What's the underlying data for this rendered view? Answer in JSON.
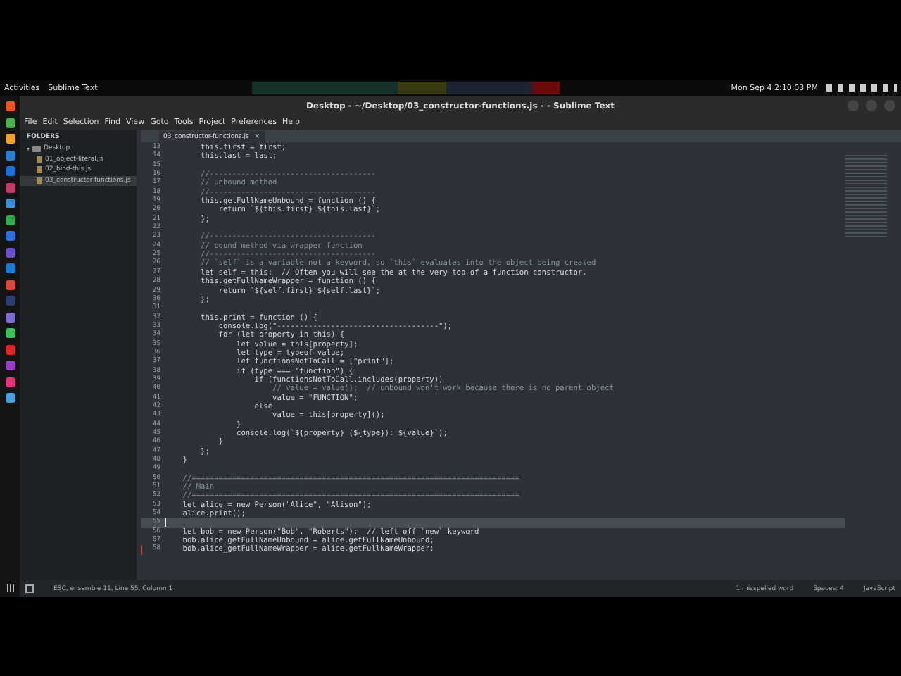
{
  "top_bar": {
    "activities": "Activities",
    "app": "Sublime Text",
    "clock": "Mon Sep 4  2:10:03 PM"
  },
  "dock": [
    {
      "color": "#e95420"
    },
    {
      "color": "#4caf50"
    },
    {
      "color": "#f0a030"
    },
    {
      "color": "#2a7fd4"
    },
    {
      "color": "#1e6fd9"
    },
    {
      "color": "#c43b6b"
    },
    {
      "color": "#3b8fd9"
    },
    {
      "color": "#2fa84f"
    },
    {
      "color": "#2d6ee0"
    },
    {
      "color": "#6a4fc7"
    },
    {
      "color": "#1b79d6"
    },
    {
      "color": "#d9483b"
    },
    {
      "color": "#2c3e70"
    },
    {
      "color": "#7a6fd0"
    },
    {
      "color": "#3bbf5a"
    },
    {
      "color": "#d92b2b"
    },
    {
      "color": "#a03bd0"
    },
    {
      "color": "#e0357a"
    },
    {
      "color": "#4a9fd8"
    }
  ],
  "window": {
    "title": "Desktop - ~/Desktop/03_constructor-functions.js - - Sublime Text"
  },
  "menu": [
    "File",
    "Edit",
    "Selection",
    "Find",
    "View",
    "Goto",
    "Tools",
    "Project",
    "Preferences",
    "Help"
  ],
  "sidebar": {
    "header": "FOLDERS",
    "folder": {
      "name": "Desktop",
      "expanded": true,
      "children": [
        {
          "name": "01_object-literal.js",
          "selected": false
        },
        {
          "name": "02_bind-this.js",
          "selected": false
        },
        {
          "name": "03_constructor-functions.js",
          "selected": true
        }
      ]
    }
  },
  "tabs": [
    {
      "label": "03_constructor-functions.js",
      "close": "×",
      "selected": true
    }
  ],
  "lines": [
    {
      "n": "13",
      "kind": "code",
      "text": "        this.first = first;",
      "current": false,
      "modified": false
    },
    {
      "n": "14",
      "kind": "code",
      "text": "        this.last = last;",
      "current": false,
      "modified": false
    },
    {
      "n": "15",
      "current": false,
      "modified": false
    },
    {
      "n": "16",
      "kind": "comment",
      "text": "        //-------------------------------------",
      "current": false,
      "modified": false
    },
    {
      "n": "17",
      "kind": "comment",
      "text": "        // unbound method",
      "current": false,
      "modified": false
    },
    {
      "n": "18",
      "kind": "comment",
      "text": "        //-------------------------------------",
      "current": false,
      "modified": false
    },
    {
      "n": "19",
      "kind": "code",
      "text": "        this.getFullNameUnbound = function () {",
      "current": false,
      "modified": false
    },
    {
      "n": "20",
      "kind": "code",
      "text": "            return `${this.first} ${this.last}`;",
      "current": false,
      "modified": false
    },
    {
      "n": "21",
      "kind": "code",
      "text": "        };",
      "current": false,
      "modified": false
    },
    {
      "n": "22",
      "current": false,
      "modified": false
    },
    {
      "n": "23",
      "kind": "comment",
      "text": "        //-------------------------------------",
      "current": false,
      "modified": false
    },
    {
      "n": "24",
      "kind": "comment",
      "text": "        // bound method via wrapper function",
      "current": false,
      "modified": false
    },
    {
      "n": "25",
      "kind": "comment",
      "text": "        //-------------------------------------",
      "current": false,
      "modified": false
    },
    {
      "n": "26",
      "kind": "comment",
      "text": "        // `self` is a variable not a keyword, so `this` evaluates into the object being created",
      "current": false,
      "modified": false
    },
    {
      "n": "27",
      "kind": "code",
      "text": "        let self = this;  // Often you will see the at the very top of a function constructor.",
      "current": false,
      "modified": false
    },
    {
      "n": "28",
      "kind": "code",
      "text": "        this.getFullNameWrapper = function () {",
      "current": false,
      "modified": false
    },
    {
      "n": "29",
      "kind": "code",
      "text": "            return `${self.first} ${self.last}`;",
      "current": false,
      "modified": false
    },
    {
      "n": "30",
      "kind": "code",
      "text": "        };",
      "current": false,
      "modified": false
    },
    {
      "n": "31",
      "current": false,
      "modified": false
    },
    {
      "n": "32",
      "kind": "code",
      "text": "        this.print = function () {",
      "current": false,
      "modified": false
    },
    {
      "n": "33",
      "kind": "code",
      "text": "            console.log(\"------------------------------------\");",
      "current": false,
      "modified": false
    },
    {
      "n": "34",
      "kind": "code",
      "text": "            for (let property in this) {",
      "current": false,
      "modified": false
    },
    {
      "n": "35",
      "kind": "code",
      "text": "                let value = this[property];",
      "current": false,
      "modified": false
    },
    {
      "n": "36",
      "kind": "code",
      "text": "                let type = typeof value;",
      "current": false,
      "modified": false
    },
    {
      "n": "37",
      "kind": "code",
      "text": "                let functionsNotToCall = [\"print\"];",
      "current": false,
      "modified": false
    },
    {
      "n": "38",
      "kind": "code",
      "text": "                if (type === \"function\") {",
      "current": false,
      "modified": false
    },
    {
      "n": "39",
      "kind": "code",
      "text": "                    if (functionsNotToCall.includes(property))",
      "current": false,
      "modified": false
    },
    {
      "n": "40",
      "kind": "comment",
      "text": "                        // value = value();  // unbound won't work because there is no parent object",
      "current": false,
      "modified": false
    },
    {
      "n": "41",
      "kind": "code",
      "text": "                        value = \"FUNCTION\";",
      "current": false,
      "modified": false
    },
    {
      "n": "42",
      "kind": "code",
      "text": "                    else",
      "current": false,
      "modified": false
    },
    {
      "n": "43",
      "kind": "code",
      "text": "                        value = this[property]();",
      "current": false,
      "modified": false
    },
    {
      "n": "44",
      "kind": "code",
      "text": "                }",
      "current": false,
      "modified": false
    },
    {
      "n": "45",
      "kind": "code",
      "text": "                console.log(`${property} (${type}): ${value}`);",
      "current": false,
      "modified": false
    },
    {
      "n": "46",
      "kind": "code",
      "text": "            }",
      "current": false,
      "modified": false
    },
    {
      "n": "47",
      "kind": "code",
      "text": "        };",
      "current": false,
      "modified": false
    },
    {
      "n": "48",
      "kind": "code",
      "text": "    }",
      "current": false,
      "modified": false
    },
    {
      "n": "49",
      "current": false,
      "modified": false
    },
    {
      "n": "50",
      "kind": "comment",
      "text": "    //=========================================================================",
      "current": false,
      "modified": false
    },
    {
      "n": "51",
      "kind": "comment",
      "text": "    // Main",
      "current": false,
      "modified": false
    },
    {
      "n": "52",
      "kind": "comment",
      "text": "    //=========================================================================",
      "current": false,
      "modified": false
    },
    {
      "n": "53",
      "kind": "code",
      "text": "    let alice = new Person(\"Alice\", \"Alison\");",
      "current": false,
      "modified": false
    },
    {
      "n": "54",
      "kind": "code",
      "text": "    alice.print();",
      "current": false,
      "modified": false
    },
    {
      "n": "55",
      "current": true,
      "modified": false
    },
    {
      "n": "56",
      "kind": "code",
      "text": "    let bob = new Person(\"Bob\", \"Roberts\");  // left off `new` keyword",
      "current": false,
      "modified": false
    },
    {
      "n": "57",
      "kind": "code",
      "text": "    bob.alice_getFullNameUnbound = alice.getFullNameUnbound;",
      "current": false,
      "modified": false
    },
    {
      "n": "58",
      "kind": "code",
      "text": "    bob.alice_getFullNameWrapper = alice.getFullNameWrapper;",
      "current": false,
      "modified": true
    }
  ],
  "status_bar": {
    "position": "ESC, ensemble 11, Line 55, Column 1",
    "spelling": "1 misspelled word",
    "indent": "Spaces: 4",
    "syntax": "JavaScript"
  }
}
